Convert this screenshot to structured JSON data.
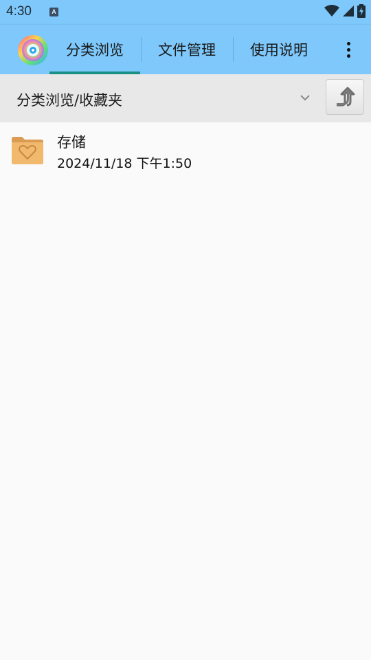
{
  "status_bar": {
    "time": "4:30",
    "notification_icon_letter": "A",
    "icons": [
      "wifi-icon",
      "signal-icon",
      "battery-charging-icon"
    ]
  },
  "app_bar": {
    "logo_icon": "app-logo-icon",
    "tabs": [
      {
        "label": "分类浏览",
        "active": true
      },
      {
        "label": "文件管理",
        "active": false
      },
      {
        "label": "使用说明",
        "active": false
      }
    ],
    "overflow_icon": "more-vert-icon",
    "accent_color": "#1a8f85",
    "bar_color": "#7ec8fb"
  },
  "path_bar": {
    "path": "分类浏览/收藏夹",
    "dropdown_icon": "chevron-down-icon",
    "up_icon": "up-arrow-icon"
  },
  "files": [
    {
      "name": "存储",
      "date": "2024/11/18 下午1:50",
      "icon": "favorite-folder-icon"
    }
  ]
}
